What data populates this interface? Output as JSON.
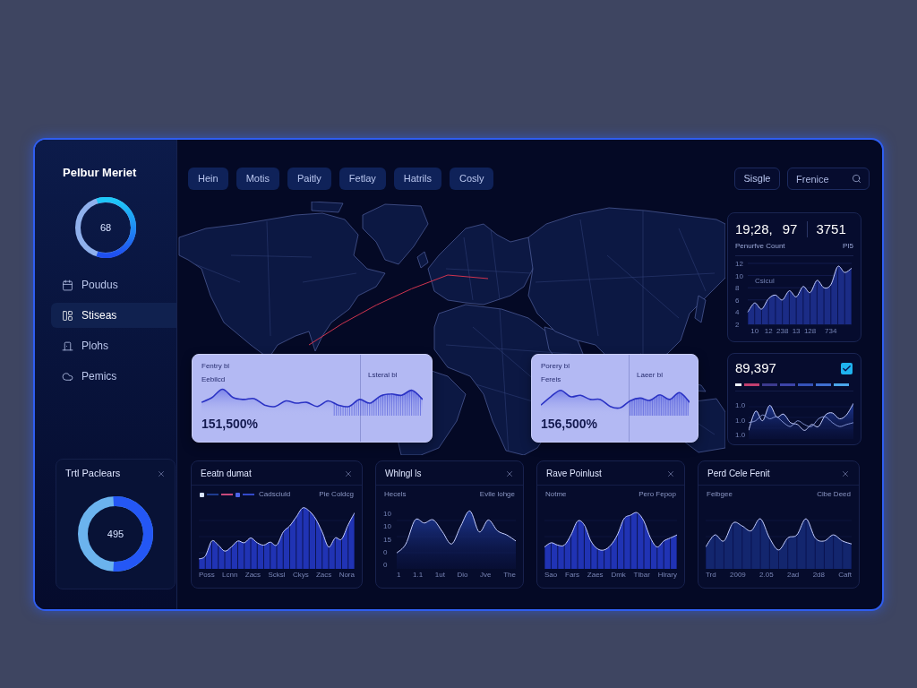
{
  "sidebar": {
    "title": "Pelbur Meriet",
    "gauge": {
      "value": "68",
      "level": 0.6
    },
    "nav_items": [
      {
        "label": "Poudus",
        "selected": false
      },
      {
        "label": "Stiseas",
        "selected": true
      },
      {
        "label": "Plohs",
        "selected": false
      },
      {
        "label": "Pemics",
        "selected": false
      }
    ],
    "widget": {
      "title": "Trtl Paclears",
      "gauge": {
        "value": "495",
        "level": 0.52
      }
    }
  },
  "toolbar": {
    "tabs": [
      "Hein",
      "Motis",
      "Paitly",
      "Fetlay",
      "Hatrils",
      "Cosly"
    ],
    "button": "Sisgle",
    "search": {
      "placeholder": "Frenice"
    }
  },
  "map_cards": [
    {
      "label": "Fentry bl",
      "sublabel": "Eebilcd",
      "side_label": "Lsteral bl",
      "value": "151,500%"
    },
    {
      "label": "Porery bl",
      "sublabel": "Fereis",
      "side_label": "Laeer bl",
      "value": "156,500%"
    }
  ],
  "stats_card": {
    "values": [
      "19;28,",
      "97",
      "3751"
    ],
    "label": "Penurfve Count",
    "code": "PI5",
    "chart_label": "Csicul",
    "chart_data": {
      "type": "area",
      "categories": [
        null,
        "10",
        null,
        "12",
        null,
        "238",
        null,
        "13",
        null,
        "128",
        null,
        null,
        "734",
        null,
        null,
        null
      ],
      "values": [
        4,
        5.5,
        4.5,
        6.2,
        6.8,
        6,
        7.5,
        6.5,
        8.2,
        7.2,
        9.2,
        8,
        8.5,
        11.5,
        10.5,
        11.2
      ],
      "ylim": [
        2,
        12
      ],
      "yticks": [
        12,
        10,
        8,
        6,
        4,
        2
      ],
      "grid": true
    }
  },
  "balance_card": {
    "value": "89,397",
    "checked": true,
    "legend": [
      {
        "color": "#eef2ff"
      },
      {
        "color": "#c13f6f"
      },
      {
        "color": "#3b3a8e"
      },
      {
        "color": "#3c44a8"
      },
      {
        "color": "#3552b8"
      },
      {
        "color": "#3f6fd0"
      },
      {
        "color": "#4aa6ea"
      }
    ],
    "y_labels": [
      "1.0",
      "1.0",
      "1.0"
    ]
  },
  "panels": [
    {
      "kind": "bars",
      "title": "Eeatn dumat",
      "legend": {
        "swatches": [
          {
            "kind": "square",
            "color": "#d6e2ff"
          },
          {
            "kind": "line",
            "color": "#1e3b8f"
          },
          {
            "kind": "line",
            "color": "#c8497c"
          },
          {
            "kind": "square",
            "color": "#4b63e6"
          },
          {
            "kind": "line",
            "color": "#3349c8"
          }
        ],
        "label": "Cadsciuld"
      },
      "note": "Pie Coldcg",
      "x_labels": [
        "Poss",
        "Lcnn",
        "Zacs",
        "Scksl",
        "Ckys",
        "Zacs",
        "Nora"
      ]
    },
    {
      "kind": "area",
      "title": "Whlngl ls",
      "subtitle": "Hecels",
      "note": "Evlle lohge",
      "y_labels": [
        "10",
        "10",
        "15",
        "0",
        "0"
      ],
      "x_labels": [
        "1",
        "1.1",
        "1ut",
        "Dio",
        "Jve",
        "The"
      ]
    },
    {
      "kind": "bars",
      "title": "Rave Poinlust",
      "subtitle": "Notme",
      "note": "Pero Fepop",
      "x_labels": [
        "Sao",
        "Fars",
        "Zaes",
        "Dmk",
        "Tlbar",
        "Hlrary"
      ]
    },
    {
      "kind": "bars",
      "title": "Perd Cele Fenit",
      "subtitle": "Feibgee",
      "note": "Cibe Deed",
      "x_labels": [
        "Trd",
        "2009",
        "2.05",
        "2ad",
        "2d8",
        "Caft"
      ]
    }
  ]
}
